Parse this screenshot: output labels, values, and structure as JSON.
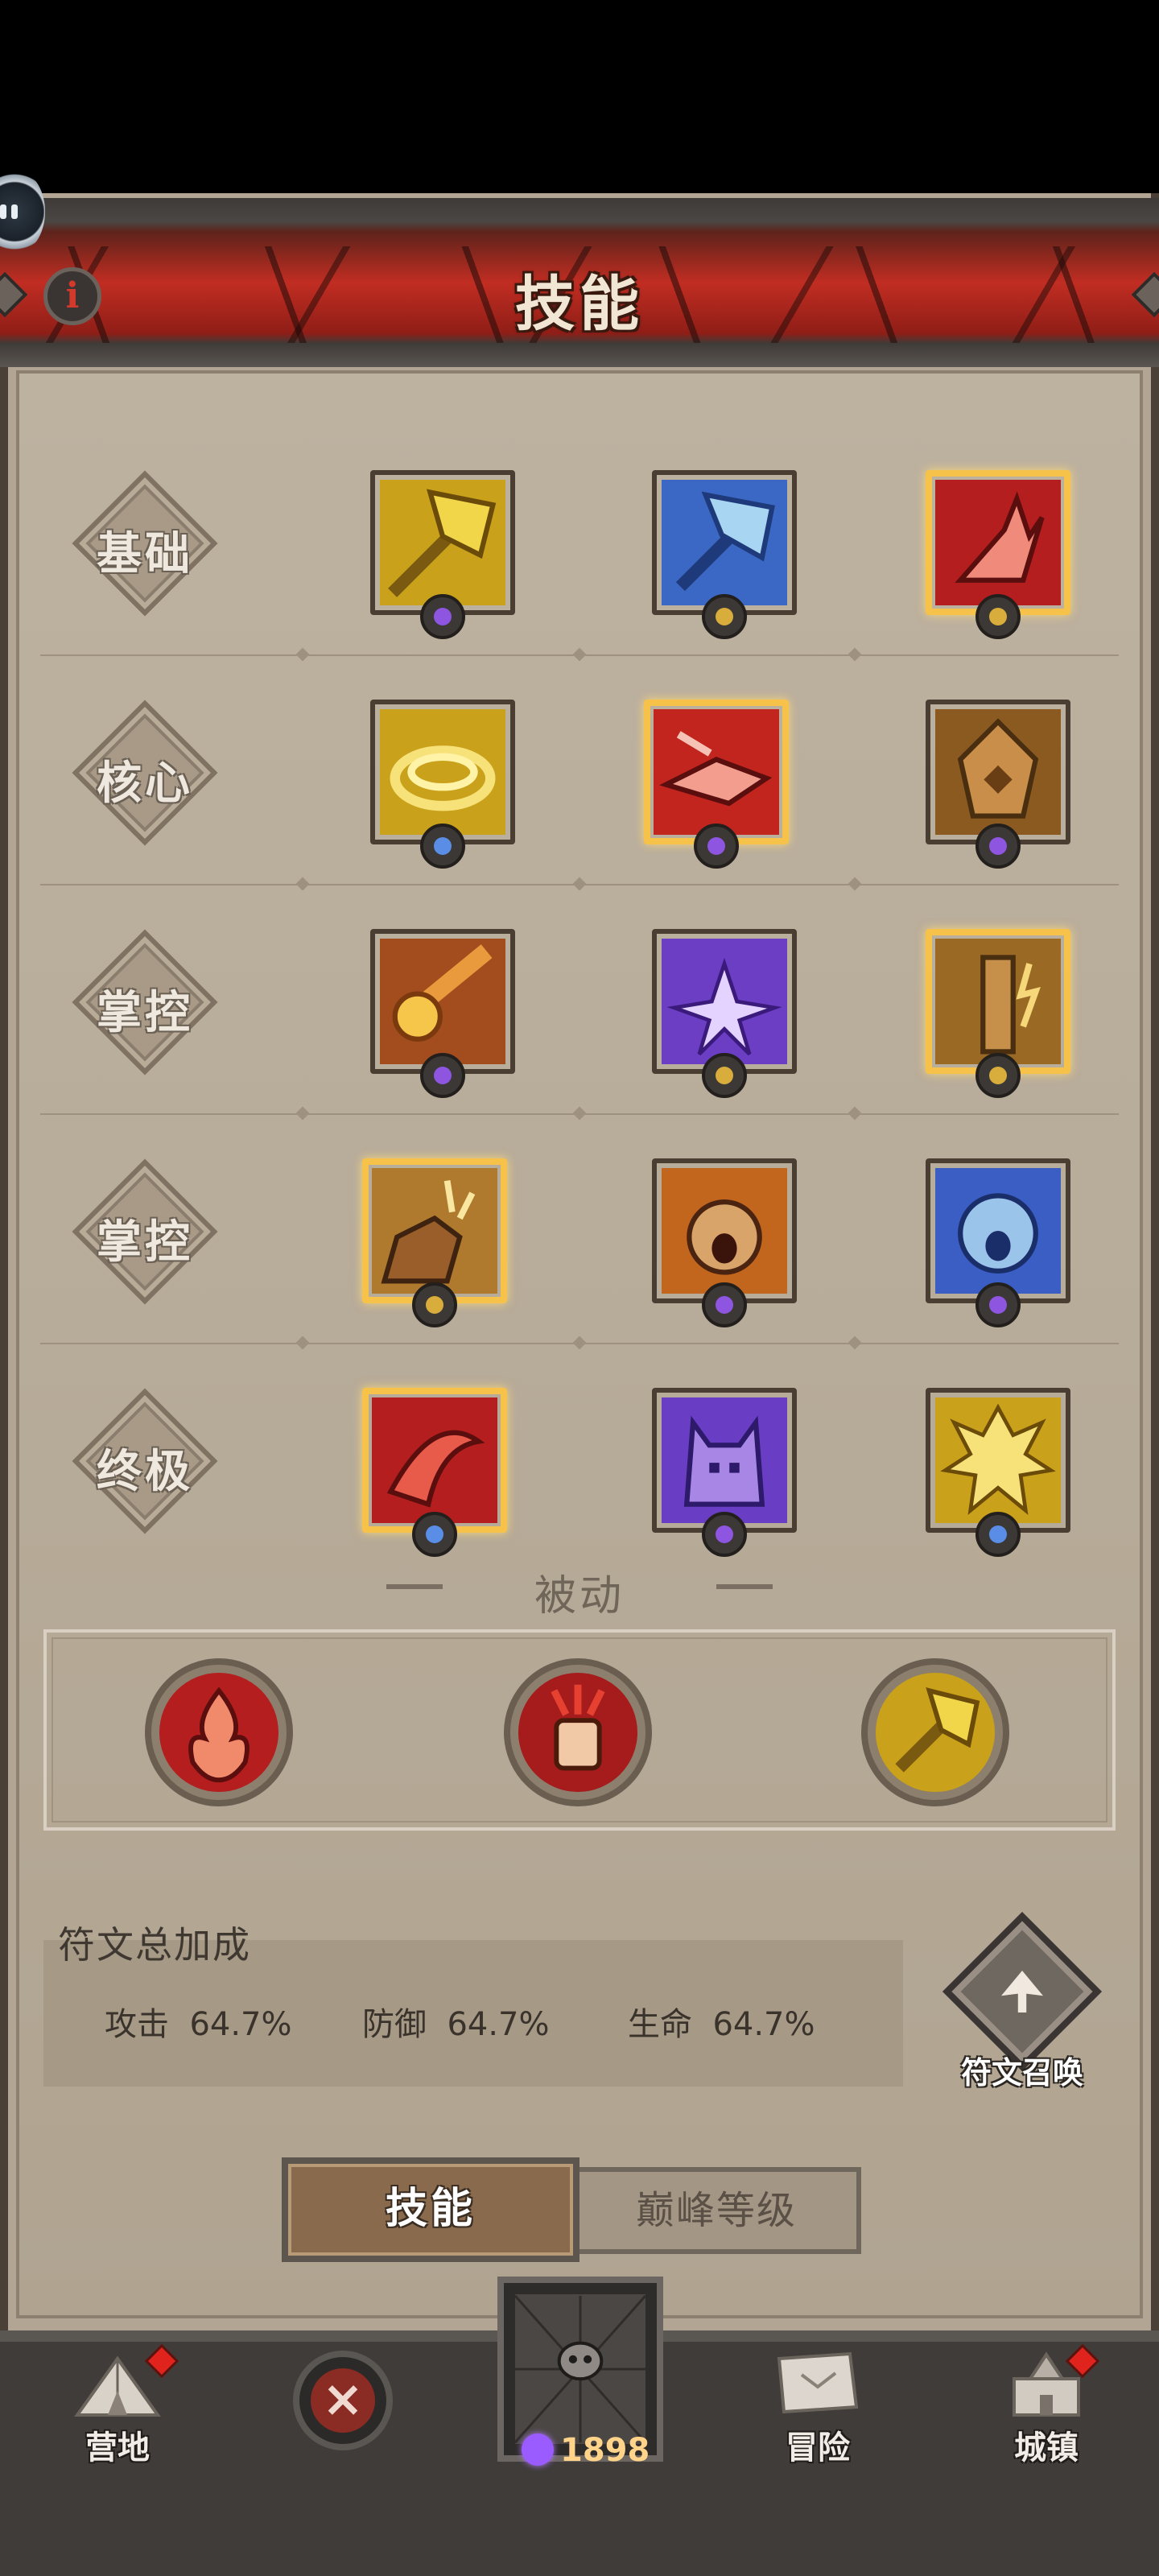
{
  "header": {
    "title": "技能",
    "info_symbol": "i"
  },
  "rows": [
    {
      "label": "基础"
    },
    {
      "label": "核心"
    },
    {
      "label": "掌控"
    },
    {
      "label": "掌控"
    },
    {
      "label": "终极"
    }
  ],
  "passive": {
    "title": "被动"
  },
  "bonus": {
    "title": "符文总加成",
    "items": [
      {
        "label": "攻击",
        "value": "64.7%"
      },
      {
        "label": "防御",
        "value": "64.7%"
      },
      {
        "label": "生命",
        "value": "64.7%"
      }
    ]
  },
  "rune_summon": {
    "label": "符文召唤"
  },
  "tabs": {
    "active": "技能",
    "inactive": "巅峰等级"
  },
  "nav": {
    "camp": "营地",
    "adventure": "冒险",
    "town": "城镇",
    "gem_count": "1898"
  }
}
